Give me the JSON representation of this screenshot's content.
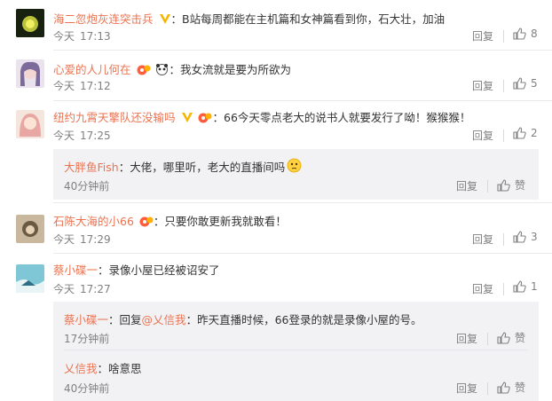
{
  "comments": [
    {
      "user": "海二忽炮灰连突击兵",
      "text": "B站每周都能在主机篇和女神篇看到你，石大壮，加油",
      "date": "今天",
      "time": "17:13",
      "reply": "回复",
      "likes": "8"
    },
    {
      "user": "心爱的人儿何在",
      "text": "我女流就是要为所欲为",
      "date": "今天",
      "time": "17:12",
      "reply": "回复",
      "likes": "5"
    },
    {
      "user": "纽约九霄天擎队还没输吗",
      "text": "66今天零点老大的说书人就要发行了呦！猴猴猴！",
      "date": "今天",
      "time": "17:25",
      "reply": "回复",
      "likes": "2"
    },
    {
      "user": "石陈大海的小66",
      "text": "只要你敢更新我就敢看！",
      "date": "今天",
      "time": "17:29",
      "reply": "回复",
      "likes": "3"
    },
    {
      "user": "蔡小碟一",
      "text": "录像小屋已经被诏安了",
      "date": "今天",
      "time": "17:27",
      "reply": "回复",
      "likes": "1"
    }
  ],
  "subreplies": [
    {
      "user": "大胖鱼Fish",
      "text": "大佬，哪里听，老大的直播间吗",
      "time": "40分钟前",
      "reply": "回复",
      "like": "赞"
    },
    {
      "user": "蔡小碟一",
      "reply_word": "回复",
      "mention": "@乂信我",
      "text": "昨天直播时候，66登录的就是录像小屋的号。",
      "time": "17分钟前",
      "reply": "回复",
      "like": "赞"
    },
    {
      "user": "乂信我",
      "text": "啥意思",
      "time": "40分钟前",
      "reply": "回复",
      "like": "赞"
    }
  ],
  "icons": {
    "vip": "vip-v-icon",
    "fan": "fan-badge-icon",
    "panda": "panda-emoji-icon",
    "thinking": "thinking-emoji-icon",
    "thumb": "thumb-up-icon"
  },
  "colors": {
    "username": "#eb7350",
    "muted": "#808080",
    "subbg": "#f2f2f5"
  }
}
